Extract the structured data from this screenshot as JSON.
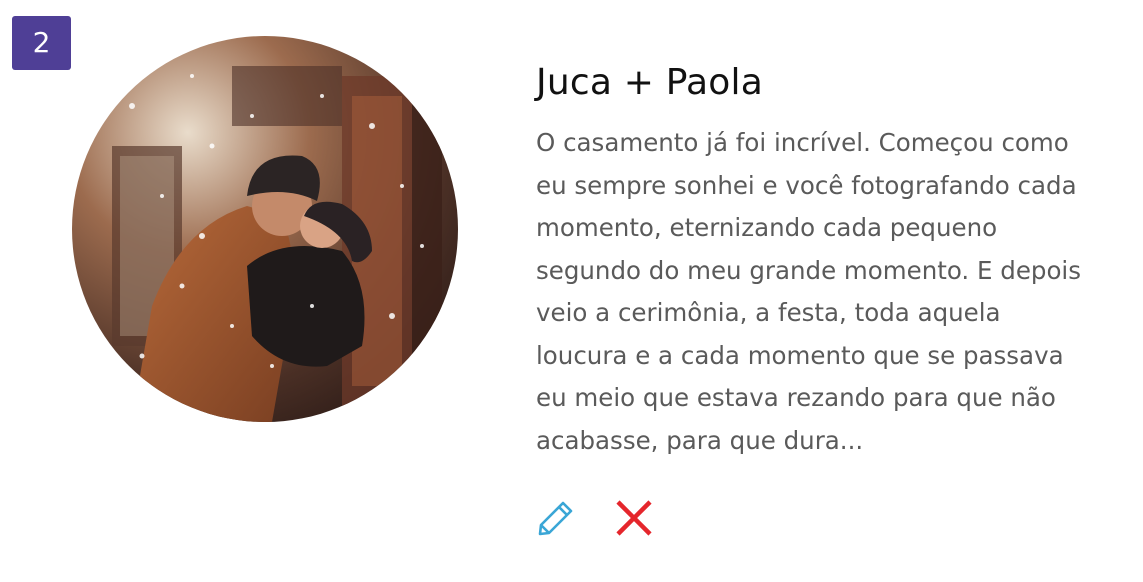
{
  "card": {
    "index": "2",
    "title": "Juca + Paola",
    "message": "O casamento já foi incrível. Começou como eu sempre sonhei e você fotografando cada momento, eternizando cada pequeno segundo do meu grande momento. E depois veio a cerimônia, a festa, toda aquela loucura e a cada momento que se passava eu meio que estava rezando para que não acabasse, para que dura..."
  },
  "actions": {
    "edit_icon": "pencil-icon",
    "delete_icon": "close-icon"
  },
  "colors": {
    "badge": "#4f3f96",
    "edit": "#3aa6d6",
    "delete": "#e5262c",
    "title": "#111111",
    "body_text": "#5a5a5a"
  }
}
